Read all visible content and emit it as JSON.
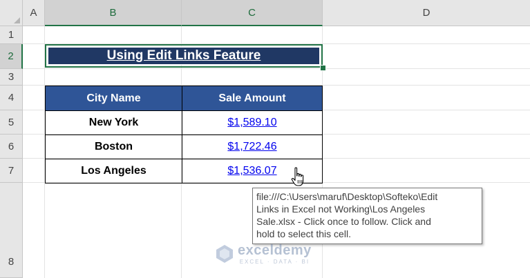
{
  "columns": [
    "A",
    "B",
    "C",
    "D"
  ],
  "rows": [
    "1",
    "2",
    "3",
    "4",
    "5",
    "6",
    "7",
    "8"
  ],
  "title": "Using Edit Links Feature",
  "table": {
    "headers": [
      "City Name",
      "Sale Amount"
    ],
    "rows": [
      {
        "city": "New York",
        "amount": "$1,589.10"
      },
      {
        "city": "Boston",
        "amount": "$1,722.46"
      },
      {
        "city": "Los Angeles",
        "amount": "$1,536.07"
      }
    ]
  },
  "tooltip": {
    "lines": [
      "file:///C:\\Users\\maruf\\Desktop\\Softeko\\Edit",
      "Links in Excel not Working\\Los Angeles",
      "Sale.xlsx - Click once to follow. Click and",
      "hold to select this cell."
    ]
  },
  "watermark": {
    "name": "exceldemy",
    "tagline": "EXCEL · DATA · BI"
  },
  "colors": {
    "header_fill": "#2f5597",
    "title_fill": "#203864",
    "selection": "#217346",
    "link": "#0000ee"
  }
}
